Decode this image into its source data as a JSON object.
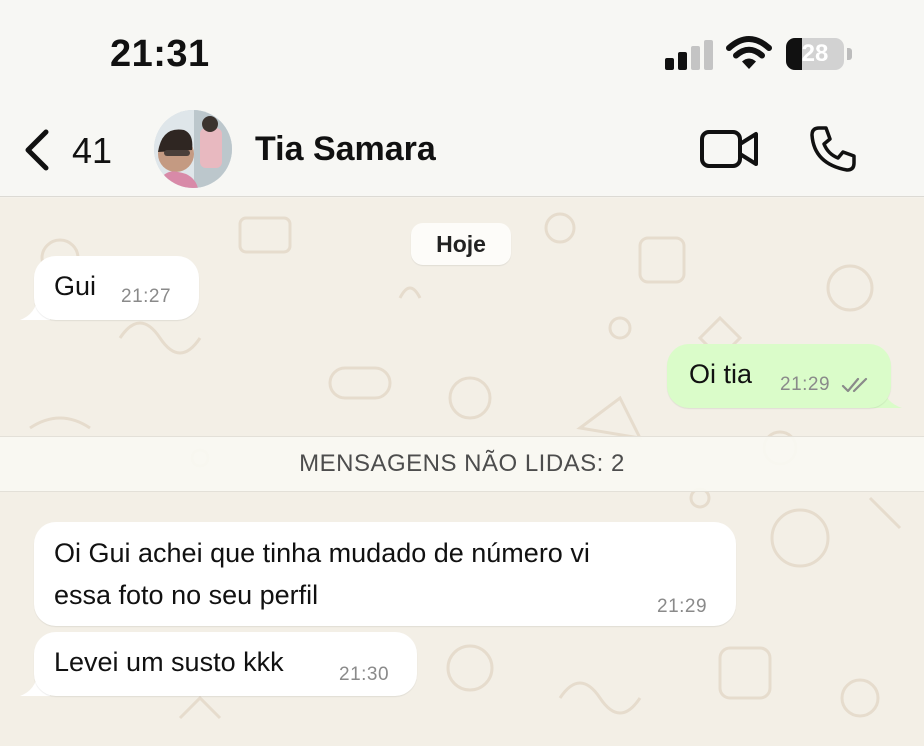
{
  "status_bar": {
    "time": "21:31",
    "battery_percent": "28",
    "battery_level": 0.28,
    "signal_bars": 2
  },
  "header": {
    "back_count": "41",
    "contact_name": "Tia Samara",
    "icons": [
      "chevron-left-icon",
      "video-camera-icon",
      "phone-icon"
    ]
  },
  "chat": {
    "date_label": "Hoje",
    "unread_banner": "MENSAGENS NÃO LIDAS: 2",
    "messages": [
      {
        "direction": "incoming",
        "text": "Gui",
        "time": "21:27"
      },
      {
        "direction": "outgoing",
        "text": "Oi tia",
        "time": "21:29",
        "status": "read"
      },
      {
        "direction": "incoming",
        "lines": [
          "Oi Gui achei que tinha mudado de número vi",
          "essa foto no seu perfil"
        ],
        "time": "21:29"
      },
      {
        "direction": "incoming",
        "text": "Levei um susto kkk",
        "time": "21:30"
      }
    ]
  },
  "colors": {
    "incoming_bubble": "#ffffff",
    "outgoing_bubble": "#dafcc9",
    "chat_background": "#f3efe6",
    "read_ticks": "#8a8a8a"
  }
}
